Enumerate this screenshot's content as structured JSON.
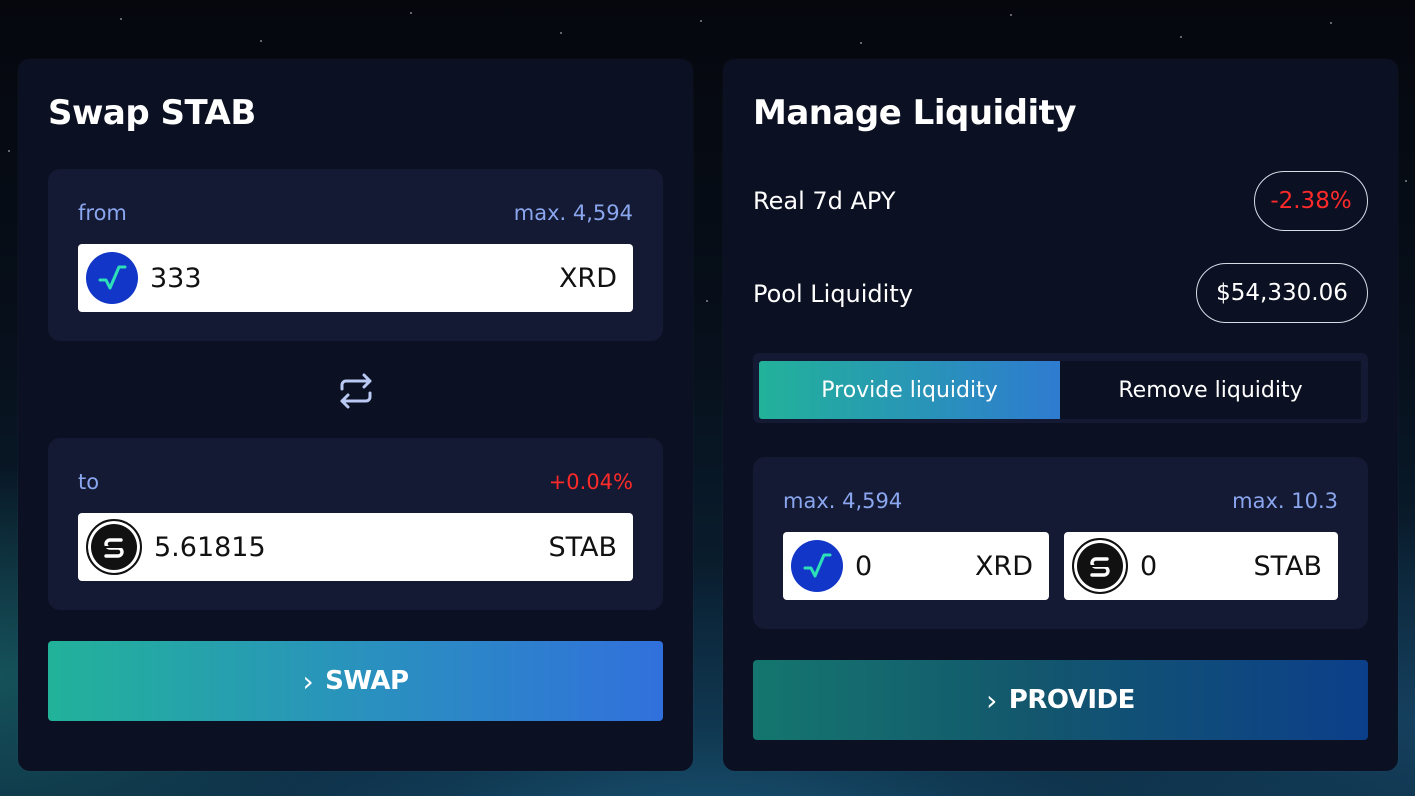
{
  "swap": {
    "title": "Swap STAB",
    "from": {
      "label": "from",
      "max": "max. 4,594",
      "amount": "333",
      "ticker": "XRD",
      "icon": "radix-xrd-icon"
    },
    "to": {
      "label": "to",
      "change": "+0.04%",
      "amount": "5.61815",
      "ticker": "STAB",
      "icon": "stab-icon"
    },
    "button_label": "SWAP",
    "button_icon": "chevron-right-icon",
    "colors": {
      "accent_start": "#22b29a",
      "accent_end": "#3170dc",
      "negative": "#ff2a2a",
      "label": "#8aa6ef"
    }
  },
  "liquidity": {
    "title": "Manage Liquidity",
    "apy": {
      "label": "Real 7d APY",
      "value": "-2.38%"
    },
    "pool": {
      "label": "Pool Liquidity",
      "value": "$54,330.06"
    },
    "tabs": [
      {
        "label": "Provide liquidity",
        "active": true
      },
      {
        "label": "Remove liquidity",
        "active": false
      }
    ],
    "inputs": {
      "xrd": {
        "max": "max. 4,594",
        "amount": "0",
        "ticker": "XRD"
      },
      "stab": {
        "max": "max. 10.3",
        "amount": "0",
        "ticker": "STAB"
      }
    },
    "button_label": "PROVIDE"
  }
}
